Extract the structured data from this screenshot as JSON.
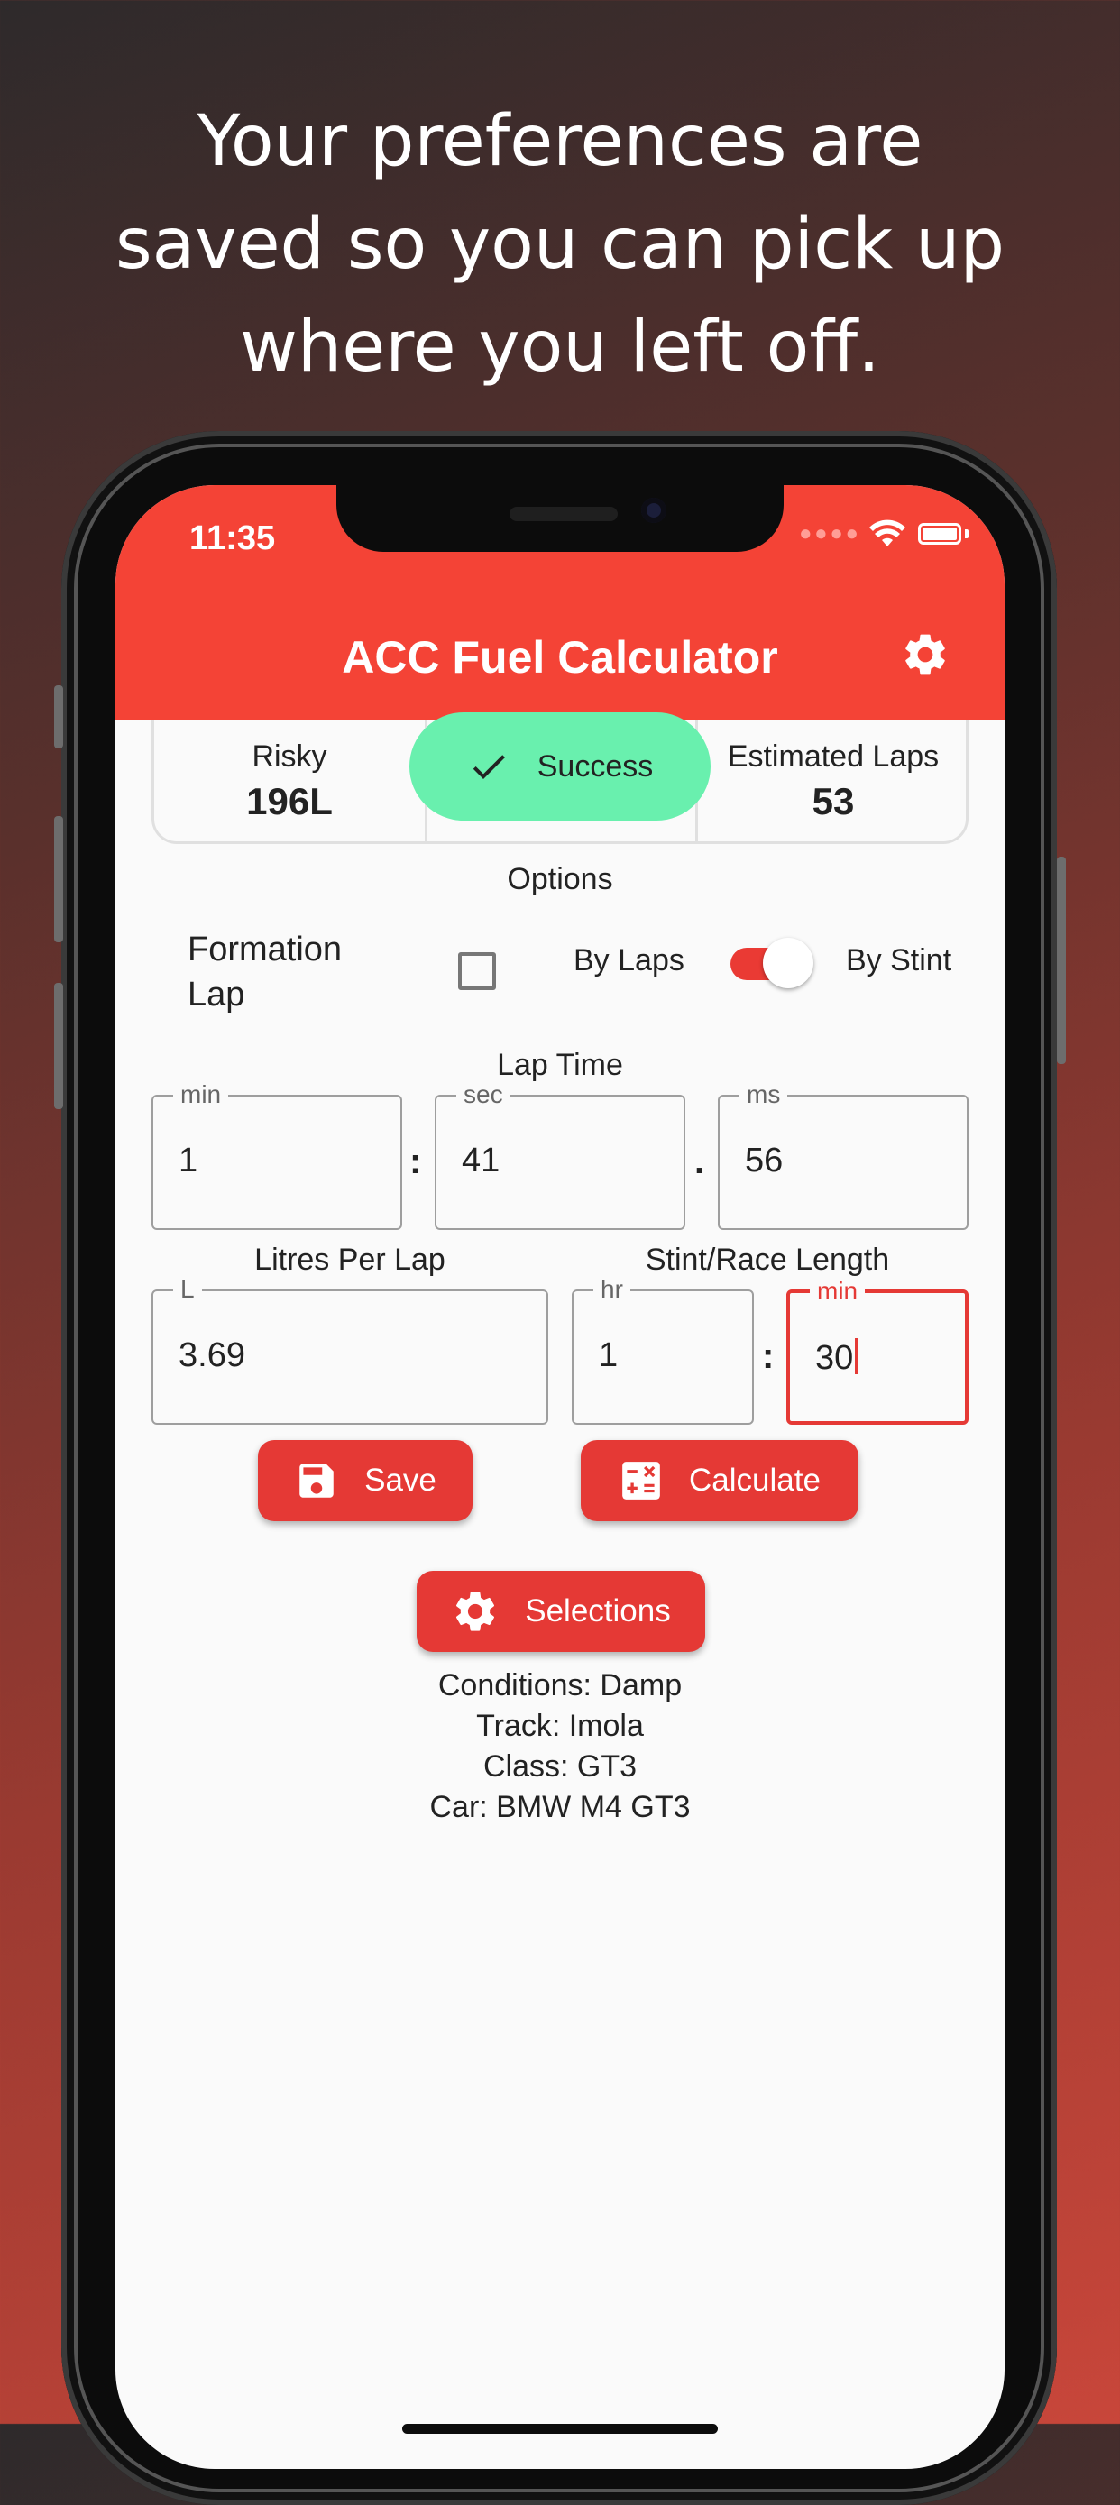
{
  "headline": {
    "line1": "Your preferences are",
    "line2": "saved so you can pick up",
    "line3": "where you left off."
  },
  "status_bar": {
    "time": "11:35"
  },
  "app_bar": {
    "title": "ACC Fuel Calculator",
    "settings_icon": "gear-icon"
  },
  "results": {
    "left_label": "Risky",
    "left_value": "196L",
    "right_label": "Estimated Laps",
    "right_value": "53"
  },
  "toast": {
    "text": "Success",
    "icon": "check-icon",
    "color": "#69f0ae"
  },
  "options": {
    "title": "Options",
    "formation_lap_line1": "Formation",
    "formation_lap_line2": "Lap",
    "formation_lap_checked": false,
    "by_laps": "By Laps",
    "by_stint": "By Stint",
    "mode_toggle_on": true
  },
  "lap_time": {
    "title": "Lap Time",
    "min_label": "min",
    "min_value": "1",
    "sep1": ":",
    "sec_label": "sec",
    "sec_value": "41",
    "sep2": ".",
    "ms_label": "ms",
    "ms_value": "56"
  },
  "litres": {
    "title": "Litres Per Lap",
    "label": "L",
    "value": "3.69"
  },
  "stint": {
    "title": "Stint/Race Length",
    "hr_label": "hr",
    "hr_value": "1",
    "sep": ":",
    "min_label": "min",
    "min_value": "30"
  },
  "buttons": {
    "save": "Save",
    "calculate": "Calculate",
    "selections": "Selections"
  },
  "info": {
    "conditions": "Conditions: Damp",
    "track": "Track: Imola",
    "class": "Class: GT3",
    "car": "Car: BMW M4 GT3"
  },
  "colors": {
    "accent": "#f44336",
    "button": "#e53935",
    "success": "#69f0ae"
  }
}
